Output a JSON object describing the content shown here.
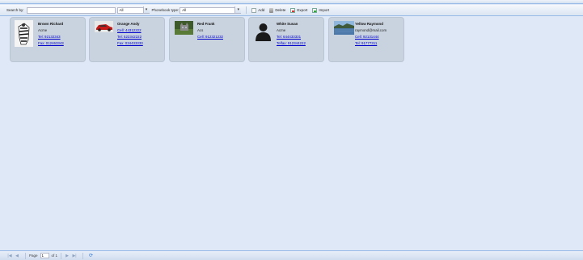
{
  "toolbar": {
    "search_label": "Search by:",
    "search_value": "",
    "filter_value": "All",
    "phonebook_type_label": "Phonebook type:",
    "phonebook_type_value": "All",
    "add_label": "Add",
    "delete_label": "Delete",
    "export_label": "Export",
    "import_label": "Import"
  },
  "contacts": [
    {
      "name": "Brown Richard",
      "lines": [
        {
          "text": "Acme",
          "link": false
        },
        {
          "text": "Tel: 92132343",
          "link": true
        },
        {
          "text": "Fax: 012463343",
          "link": true
        }
      ],
      "photo": "zebra"
    },
    {
      "name": "Orange Andy",
      "lines": [
        {
          "text": "Cell: 44312222",
          "link": true
        },
        {
          "text": "Tel: 522342222",
          "link": true
        },
        {
          "text": "Fax: 034433333",
          "link": true
        }
      ],
      "photo": "red-car"
    },
    {
      "name": "Red Frank",
      "lines": [
        {
          "text": "Acs",
          "link": false
        },
        {
          "text": "Cell: 912321232",
          "link": true
        }
      ],
      "photo": "cat"
    },
    {
      "name": "White Susan",
      "lines": [
        {
          "text": "Acme",
          "link": false
        },
        {
          "text": "Tel: 644433331",
          "link": true
        },
        {
          "text": "Telfax: 912344222",
          "link": true
        }
      ],
      "photo": "silhouette"
    },
    {
      "name": "Yellow Raymond",
      "lines": [
        {
          "text": "raymond@mail.com",
          "link": false
        },
        {
          "text": "Cell: 92131444",
          "link": true
        },
        {
          "text": "Tel: 91777311",
          "link": true
        }
      ],
      "photo": "landscape"
    }
  ],
  "pager": {
    "page_label": "Page",
    "page_value": "1",
    "of_label": "of 1"
  }
}
